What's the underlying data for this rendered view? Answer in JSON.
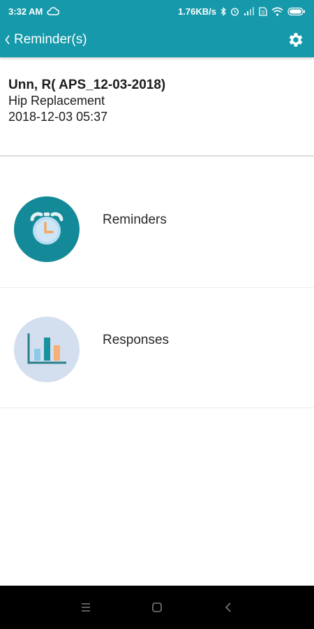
{
  "status": {
    "time": "3:32 AM",
    "speed": "1.76KB/s"
  },
  "header": {
    "title": "Reminder(s)"
  },
  "patient": {
    "name": "Unn, R( APS_12-03-2018)",
    "procedure": "Hip Replacement",
    "datetime": "2018-12-03 05:37"
  },
  "menu": [
    {
      "label": "Reminders",
      "icon": "alarm-clock-icon",
      "color": "#148a98"
    },
    {
      "label": "Responses",
      "icon": "bar-chart-icon",
      "color": "#d3deef"
    }
  ],
  "colors": {
    "primary": "#1699ab",
    "chart_line": "#2b7f8a",
    "bar_light": "#8ec9e8",
    "bar_dark": "#17929e",
    "bar_orange": "#f5b07a"
  }
}
